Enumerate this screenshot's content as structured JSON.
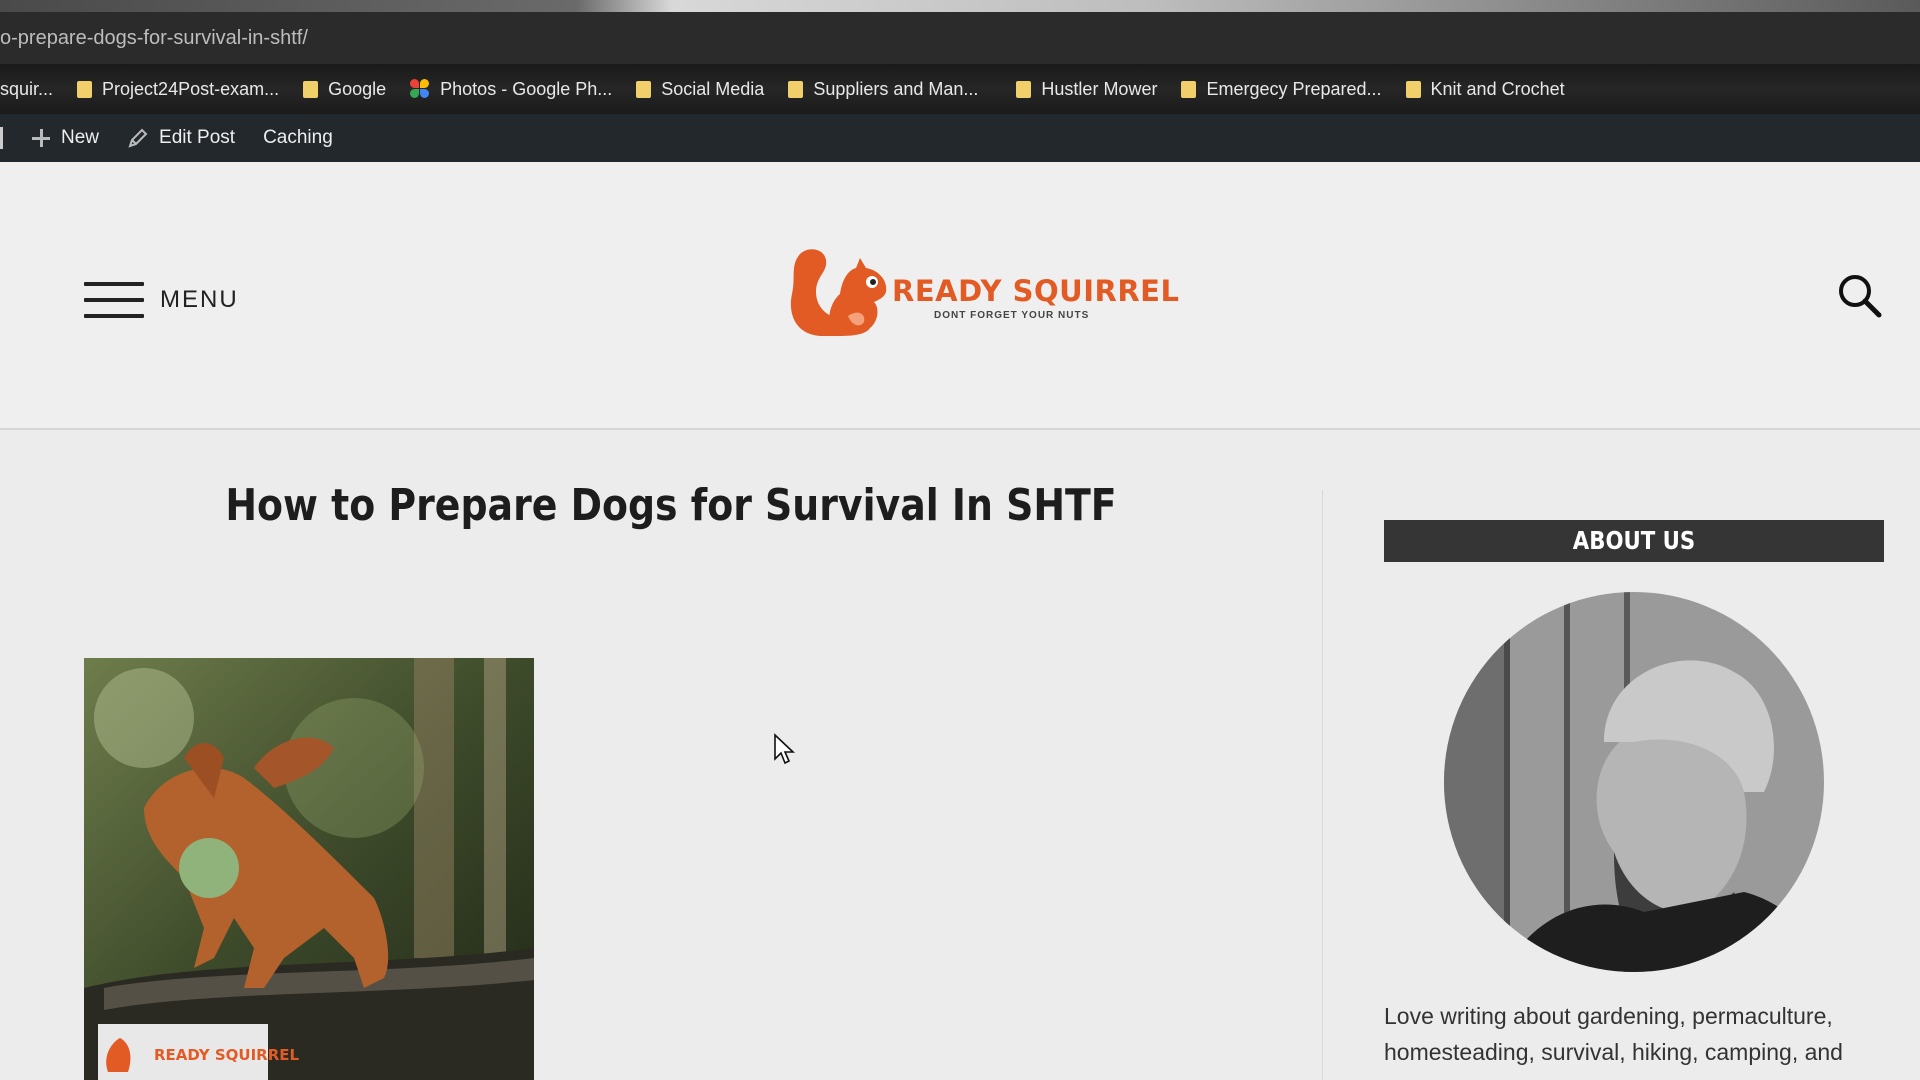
{
  "browser": {
    "url": "o-prepare-dogs-for-survival-in-shtf/",
    "bookmarks": [
      {
        "label": "squir...",
        "icon": "folder-icon"
      },
      {
        "label": "Project24Post-exam...",
        "icon": "folder-icon"
      },
      {
        "label": "Google",
        "icon": "folder-icon"
      },
      {
        "label": "Photos - Google Ph...",
        "icon": "google-photos-icon"
      },
      {
        "label": "Social Media",
        "icon": "folder-icon"
      },
      {
        "label": "Suppliers and Man...",
        "icon": "folder-icon"
      },
      {
        "label": "Hustler Mower",
        "icon": "folder-icon"
      },
      {
        "label": "Emergecy Prepared...",
        "icon": "folder-icon"
      },
      {
        "label": "Knit and Crochet",
        "icon": "folder-icon"
      }
    ]
  },
  "adminbar": {
    "new_label": "New",
    "edit_label": "Edit Post",
    "caching_label": "Caching"
  },
  "header": {
    "menu_label": "MENU",
    "logo_text": "READY SQUIRREL",
    "logo_tagline": "DONT FORGET YOUR NUTS"
  },
  "post": {
    "title": "How to Prepare Dogs for Survival In SHTF",
    "image_watermark": "READY SQUIRREL"
  },
  "sidebar": {
    "widget_title": "ABOUT US",
    "about_text": "Love writing about gardening, permaculture, homesteading, survival, hiking, camping, and"
  },
  "colors": {
    "brand": "#e35b24",
    "adminbar": "#23282d",
    "widget_title_bg": "#353535"
  }
}
